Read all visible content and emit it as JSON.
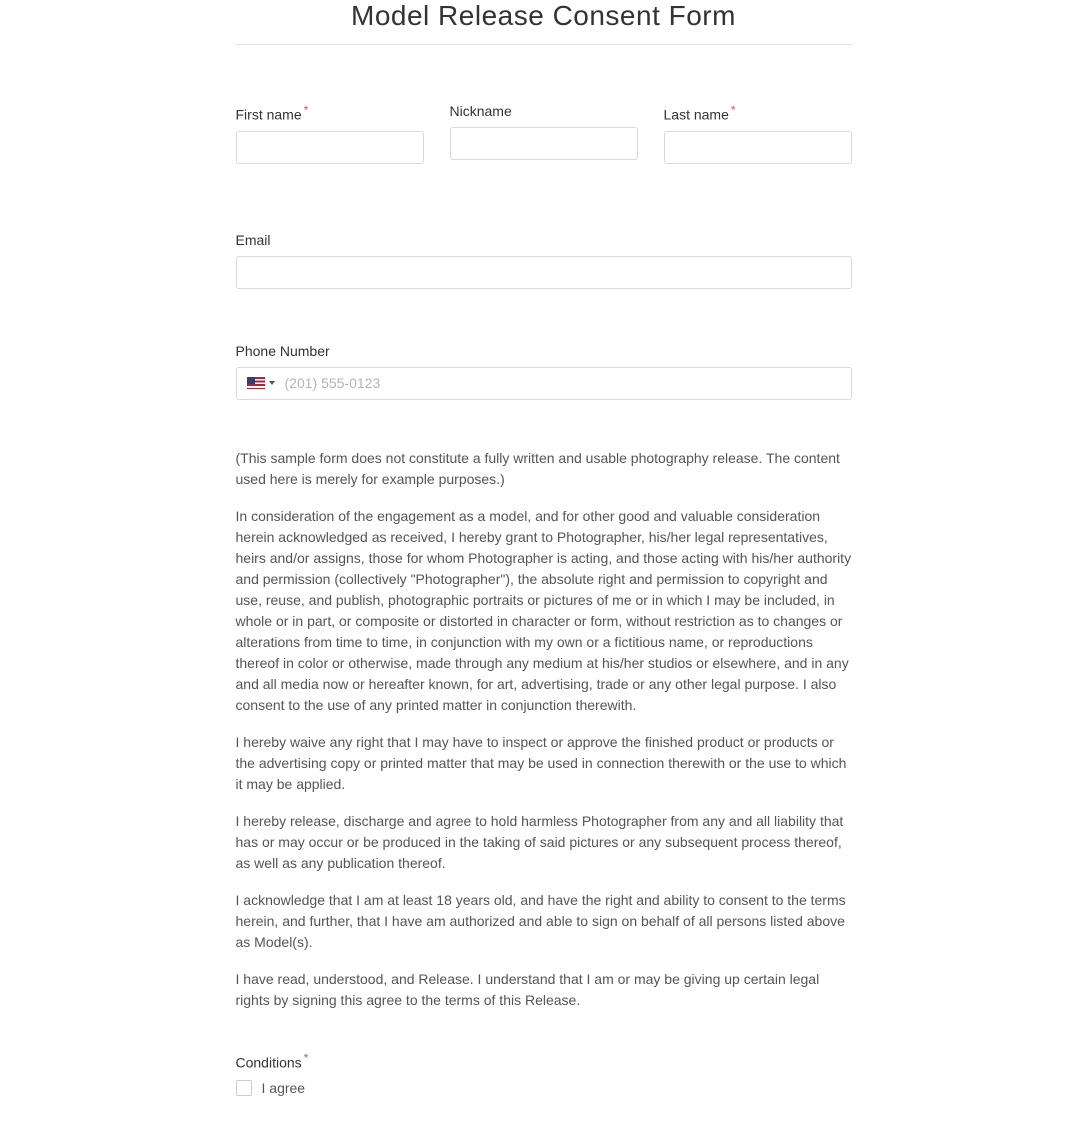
{
  "title": "Model Release Consent Form",
  "fields": {
    "first_name": {
      "label": "First name",
      "required": true,
      "value": ""
    },
    "nickname": {
      "label": "Nickname",
      "required": false,
      "value": ""
    },
    "last_name": {
      "label": "Last name",
      "required": true,
      "value": ""
    },
    "email": {
      "label": "Email",
      "value": ""
    },
    "phone": {
      "label": "Phone Number",
      "placeholder": "(201) 555-0123",
      "value": ""
    }
  },
  "consent_paragraphs": [
    "(This sample form does not constitute a fully written and usable photography release. The content used here is merely for example purposes.)",
    "In consideration of the engagement as a model, and for other good and valuable consideration herein acknowledged as received, I hereby grant to Photographer, his/her legal representatives, heirs and/or assigns, those for whom Photographer is acting, and those acting with his/her authority and permission (collectively \"Photographer\"), the absolute right and permission to copyright and use, reuse, and publish, photographic portraits or pictures of me or in which I may be included, in whole or in part, or composite or distorted in character or form, without restriction as to changes or alterations from time to time, in conjunction with my own or a fictitious name, or reproductions thereof in color or otherwise, made through any medium at his/her studios or elsewhere, and in any and all media now or hereafter known, for art, advertising, trade or any other legal purpose. I also consent to the use of any printed matter in conjunction therewith.",
    "I hereby waive any right that I may have to inspect or approve the finished product or products or the advertising copy or printed matter that may be used in connection therewith or the use to which it may be applied.",
    "I hereby release, discharge and agree to hold harmless Photographer from any and all liability that has or may occur or be produced in the taking of said pictures or any subsequent process thereof, as well as any publication thereof.",
    "I acknowledge that I am at least 18 years old, and have the right and ability to consent to the terms herein, and further, that I have am authorized and able to sign on behalf of all persons listed above as Model(s).",
    "I have read, understood, and Release. I understand that I am or may be giving up certain legal rights by signing this agree to the terms of this Release."
  ],
  "conditions": {
    "label": "Conditions",
    "required": true,
    "checkbox_label": "I agree",
    "checked": false
  },
  "required_marker": "*"
}
